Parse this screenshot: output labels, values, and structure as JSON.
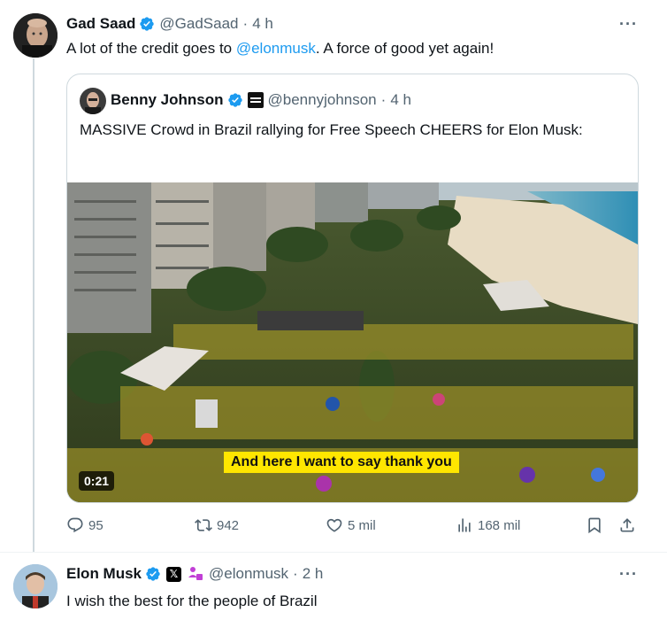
{
  "post": {
    "author": {
      "name": "Gad Saad",
      "handle": "@GadSaad",
      "dot": "·",
      "time": "4 h"
    },
    "more_label": "···",
    "text_before": "A lot of the credit goes to ",
    "mention": "@elonmusk",
    "text_after": ". A force of good yet again!",
    "quote": {
      "author": {
        "name": "Benny Johnson",
        "handle": "@bennyjohnson",
        "dot": "·",
        "time": "4 h"
      },
      "text": "MASSIVE Crowd in Brazil rallying for Free Speech CHEERS for Elon Musk:",
      "video": {
        "duration": "0:21",
        "caption": "And here I want to say thank you"
      }
    },
    "actions": {
      "replies": "95",
      "reposts": "942",
      "likes": "5 mil",
      "views": "168 mil"
    }
  },
  "reply": {
    "author": {
      "name": "Elon Musk",
      "handle": "@elonmusk",
      "dot": "·",
      "time": "2 h"
    },
    "more_label": "···",
    "text": "I wish the best for the people of Brazil"
  },
  "colors": {
    "accent": "#1d9bf0",
    "secondary_text": "#536471",
    "verified": "#1d9bf0",
    "caption_bg": "#ffe600"
  },
  "icons": {
    "verified": "verified-badge-icon",
    "reply": "reply-icon",
    "repost": "repost-icon",
    "like": "heart-icon",
    "views": "views-icon",
    "bookmark": "bookmark-icon",
    "share": "share-icon",
    "more": "more-icon"
  }
}
